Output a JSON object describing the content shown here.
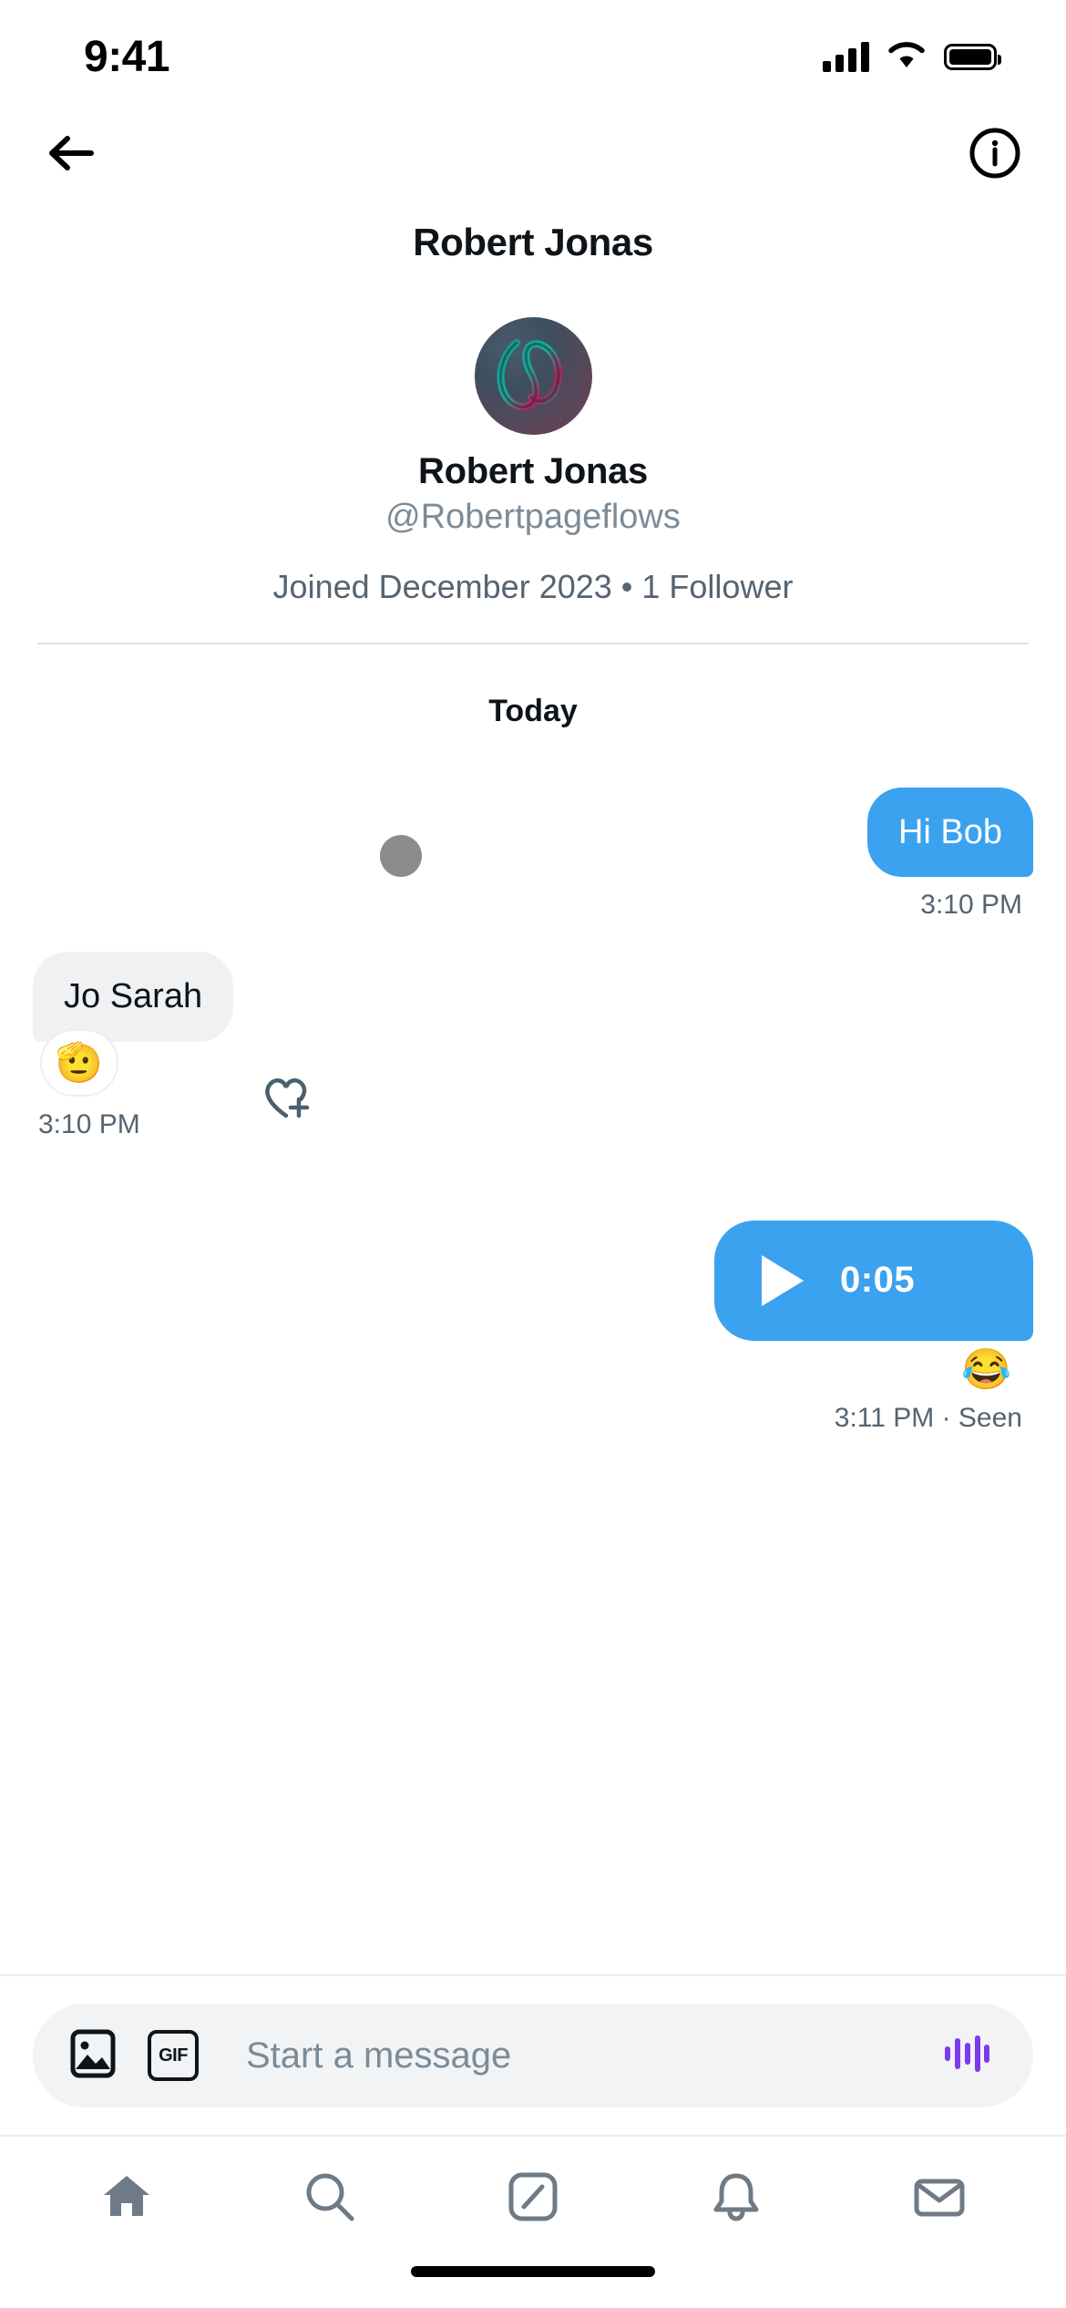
{
  "statusbar": {
    "time": "9:41",
    "cellular_icon": "cellular-signal-icon",
    "wifi_icon": "wifi-icon",
    "battery_icon": "battery-icon"
  },
  "navbar": {
    "back_icon": "back-arrow-icon",
    "info_icon": "info-circle-icon"
  },
  "header": {
    "title": "Robert Jonas"
  },
  "profile": {
    "avatar_alt": "profile-avatar",
    "name": "Robert Jonas",
    "handle": "@Robertpageflows",
    "meta": "Joined December 2023 • 1 Follower"
  },
  "conversation": {
    "day_separator": "Today",
    "messages": [
      {
        "id": "msg-1",
        "direction": "outgoing",
        "type": "text",
        "text": "Hi Bob",
        "meta": "3:10 PM"
      },
      {
        "id": "msg-2",
        "direction": "incoming",
        "type": "text",
        "text": "Jo Sarah",
        "reaction": "🫡",
        "meta": "3:10 PM",
        "add_reaction_icon": "heart-plus-icon"
      },
      {
        "id": "msg-3",
        "direction": "outgoing",
        "type": "voice",
        "duration": "0:05",
        "play_icon": "play-icon",
        "reaction": "😂",
        "meta": "3:11 PM · Seen"
      }
    ]
  },
  "composer": {
    "image_icon": "image-icon",
    "gif_icon": "gif-icon",
    "gif_label": "GIF",
    "placeholder": "Start a message",
    "voice_icon": "audio-waveform-icon"
  },
  "bottom_nav": {
    "items": [
      {
        "name": "home",
        "icon": "home-icon"
      },
      {
        "name": "search",
        "icon": "search-icon"
      },
      {
        "name": "compose",
        "icon": "compose-icon"
      },
      {
        "name": "notifications",
        "icon": "bell-icon"
      },
      {
        "name": "messages",
        "icon": "mail-icon"
      }
    ]
  },
  "colors": {
    "accent_blue": "#3aa2ef",
    "bubble_grey": "#eff1f3",
    "text_secondary": "#566471",
    "voice_purple": "#7c3aed"
  }
}
